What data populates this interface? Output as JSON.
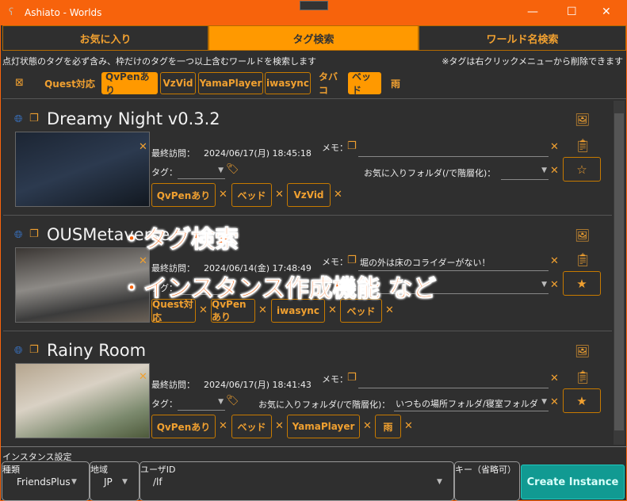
{
  "window": {
    "title": "Ashiato - Worlds",
    "minimize": "—",
    "maximize": "☐",
    "close": "✕"
  },
  "tabs": [
    "お気に入り",
    "タグ検索",
    "ワールド名検索"
  ],
  "hint_left": "点灯状態のタグを必ず含み、枠だけのタグを一つ以上含むワールドを検索します",
  "hint_right": "※タグは右クリックメニューから削除できます",
  "filter_tags": [
    {
      "label": "Quest対応",
      "state": "plain"
    },
    {
      "label": "QvPenあり",
      "state": "on"
    },
    {
      "label": "VzVid",
      "state": "outline"
    },
    {
      "label": "YamaPlayer",
      "state": "outline"
    },
    {
      "label": "iwasync",
      "state": "outline"
    },
    {
      "label": "タバコ",
      "state": "plain"
    },
    {
      "label": "ベッド",
      "state": "on"
    },
    {
      "label": "雨",
      "state": "plain"
    }
  ],
  "labels": {
    "last_visit": "最終訪問：",
    "tag": "タグ：",
    "memo": "メモ：",
    "fav_folder": "お気に入りフォルダ(/で階層化)："
  },
  "worlds": [
    {
      "name": "Dreamy Night v0.3.2",
      "last_visit": "2024/06/17(月) 18:45:18",
      "memo": "",
      "folder": "",
      "favorite": false,
      "tags": [
        "QvPenあり",
        "ベッド",
        "VzVid"
      ]
    },
    {
      "name": "OUSMetaverse",
      "last_visit": "2024/06/14(金) 17:48:49",
      "memo": "堀の外は床のコライダーがない！",
      "folder": "",
      "favorite": true,
      "tags": [
        "Quest対応",
        "QvPenあり",
        "iwasync",
        "ベッド"
      ]
    },
    {
      "name": "Rainy Room",
      "last_visit": "2024/06/17(月) 18:41:43",
      "memo": "",
      "folder": "いつもの場所フォルダ/寝室フォルダ",
      "favorite": true,
      "tags": [
        "QvPenあり",
        "ベッド",
        "YamaPlayer",
        "雨"
      ]
    }
  ],
  "overlay": [
    "・タグ検索",
    "・インスタンス作成機能 など"
  ],
  "instance": {
    "title": "インスタンス設定",
    "type_label": "種類",
    "type_value": "FriendsPlus",
    "region_label": "地域",
    "region_value": "JP",
    "user_label": "ユーザID",
    "user_value": "/lf",
    "key_label": "キー（省略可）",
    "create": "Create Instance"
  }
}
